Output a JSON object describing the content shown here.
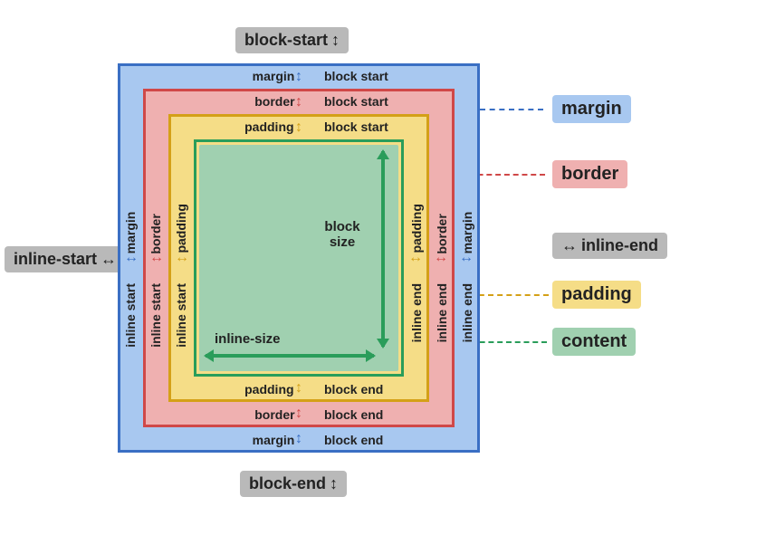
{
  "outer": {
    "block_start": "block-start",
    "block_end": "block-end",
    "inline_start": "inline-start",
    "inline_end": "inline-end"
  },
  "margin": {
    "name": "margin",
    "block_start": "block start",
    "block_end": "block end",
    "inline_start": "inline start",
    "inline_end": "inline end"
  },
  "border": {
    "name": "border",
    "block_start": "block start",
    "block_end": "block end",
    "inline_start": "inline start",
    "inline_end": "inline end"
  },
  "padding": {
    "name": "padding",
    "block_start": "block start",
    "block_end": "block end",
    "inline_start": "inline start",
    "inline_end": "inline end"
  },
  "content": {
    "block_size": "block size",
    "inline_size": "inline-size"
  },
  "legend": {
    "margin": "margin",
    "border": "border",
    "padding": "padding",
    "content": "content"
  },
  "colors": {
    "gray": "#b9b9b9",
    "blue_fill": "#a8c8f0",
    "blue_line": "#3a6fc4",
    "red_fill": "#efb0b0",
    "red_line": "#d04848",
    "yellow_fill": "#f5dd87",
    "yellow_line": "#d4a017",
    "green_fill": "#a0d0b0",
    "green_line": "#2a9d5a"
  }
}
